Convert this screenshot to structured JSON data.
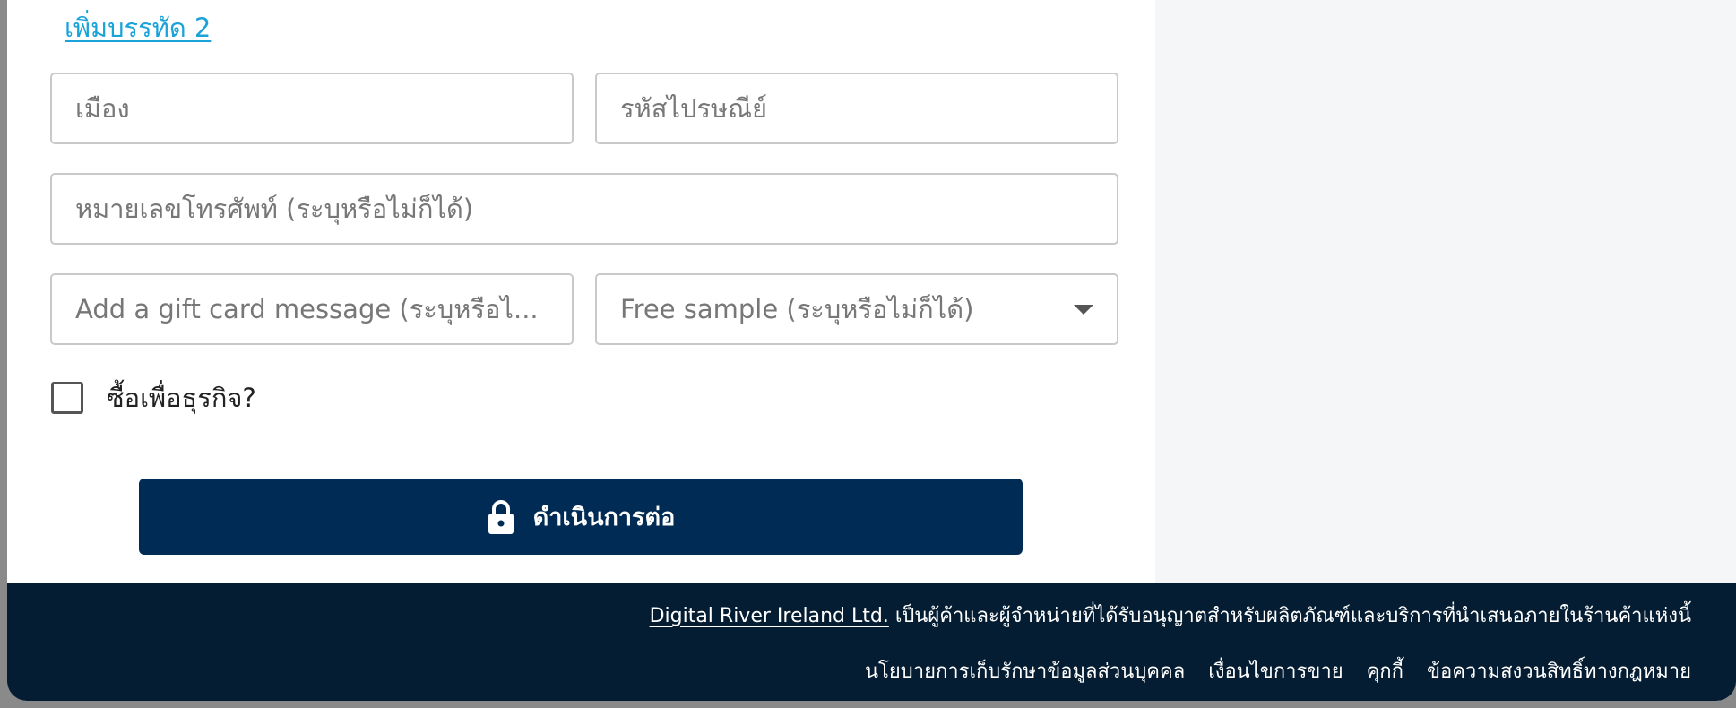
{
  "form": {
    "add_line2_link": "เพิ่มบรรทัด 2",
    "city_placeholder": "เมือง",
    "postal_placeholder": "รหัสไปรษณีย์",
    "phone_placeholder": "หมายเลขโทรศัพท์ (ระบุหรือไม่ก็ได้)",
    "gift_placeholder": "Add a gift card message (ระบุหรือไ...",
    "sample_select": "Free sample (ระบุหรือไม่ก็ได้)",
    "business_checkbox_label": "ซื้อเพื่อธุรกิจ?",
    "business_checked": false,
    "continue_label": "ดำเนินการต่อ"
  },
  "footer": {
    "company_link": "Digital River Ireland Ltd.",
    "company_text": " เป็นผู้ค้าและผู้จำหน่ายที่ได้รับอนุญาตสำหรับผลิตภัณฑ์และบริการที่นำเสนอภายในร้านค้าแห่งนี้",
    "links": [
      "นโยบายการเก็บรักษาข้อมูลส่วนบุคคล",
      "เงื่อนไขการขาย",
      "คุกกี้",
      "ข้อความสงวนสิทธิ์ทางกฎหมาย"
    ]
  },
  "colors": {
    "link": "#1aa3d9",
    "button": "#002b55",
    "footer": "#051d32",
    "side_panel": "#f5f6f7"
  },
  "icons": {
    "button_icon": "lock-icon",
    "select_icon": "chevron-down-icon"
  }
}
